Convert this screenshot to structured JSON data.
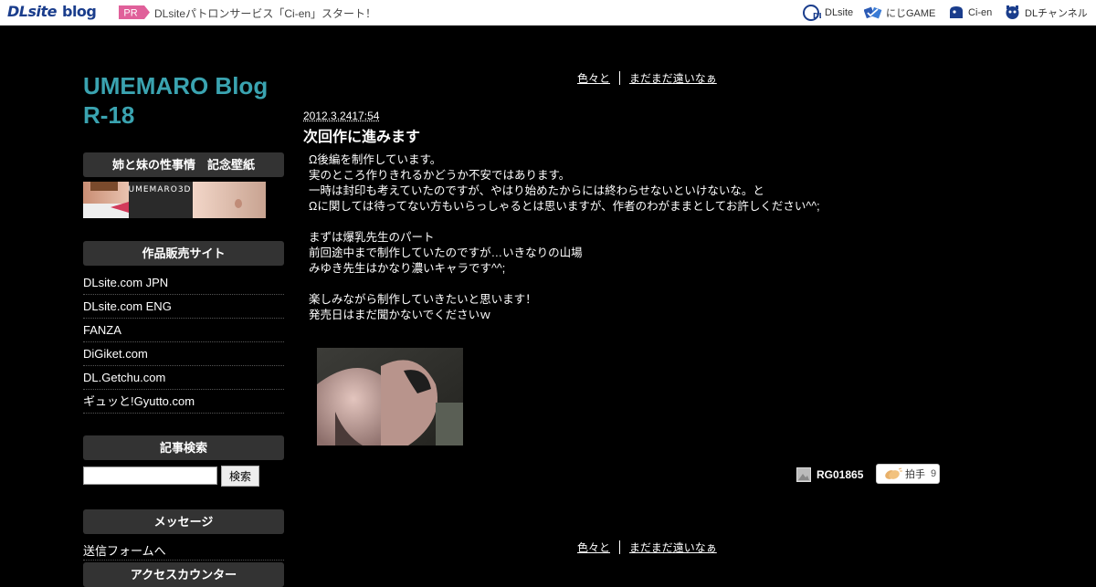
{
  "topbar": {
    "logo_main": "DLsite",
    "logo_sub": "blog",
    "pr_label": "PR",
    "pr_text": "DLsiteパトロンサービス「Ci-en」スタート！",
    "services": [
      {
        "label": "DLsite",
        "icon": "dlsite-icon"
      },
      {
        "label": "にじGAME",
        "icon": "nijigame-icon"
      },
      {
        "label": "Ci-en",
        "icon": "ci-en-icon"
      },
      {
        "label": "DLチャンネル",
        "icon": "dl-channel-icon"
      }
    ]
  },
  "sidebar": {
    "blog_title_line1": "UMEMARO Blog",
    "blog_title_line2": "R-18",
    "wallpaper_heading": "姉と妹の性事情　記念壁紙",
    "banner_text": "UMEMARO3D",
    "shops_heading": "作品販売サイト",
    "shops": [
      "DLsite.com JPN",
      "DLsite.com ENG",
      "FANZA",
      "DiGiket.com",
      "DL.Getchu.com",
      "ギュッと!Gyutto.com"
    ],
    "search_heading": "記事検索",
    "search_button": "検索",
    "search_value": "",
    "message_heading": "メッセージ",
    "message_link": "送信フォームへ",
    "counter_heading": "アクセスカウンター"
  },
  "pager": {
    "prev": "色々と",
    "next": "まだまだ遠いなぁ"
  },
  "post": {
    "date": "2012.3.2417:54",
    "title": "次回作に進みます",
    "lines": [
      "Ω後編を制作しています。",
      "実のところ作りきれるかどうか不安ではあります。",
      "一時は封印も考えていたのですが、やはり始めたからには終わらせないといけないな。と",
      "Ωに関しては待ってない方もいらっしゃるとは思いますが、作者のわがままとしてお許しください^^;",
      "",
      "まずは爆乳先生のパート",
      "前回途中まで制作していたのですが…いきなりの山場",
      "みゆき先生はかなり濃いキャラです^^;",
      "",
      "楽しみながら制作していきたいと思います！",
      "発売日はまだ聞かないでくださいｗ"
    ],
    "author": "RG01865",
    "clap_label": "拍手",
    "clap_count": "9"
  },
  "colors": {
    "background": "#000000",
    "title_accent": "#3aa3b0",
    "sidebar_heading_bg": "#333333",
    "pr_badge": "#e0609a"
  }
}
